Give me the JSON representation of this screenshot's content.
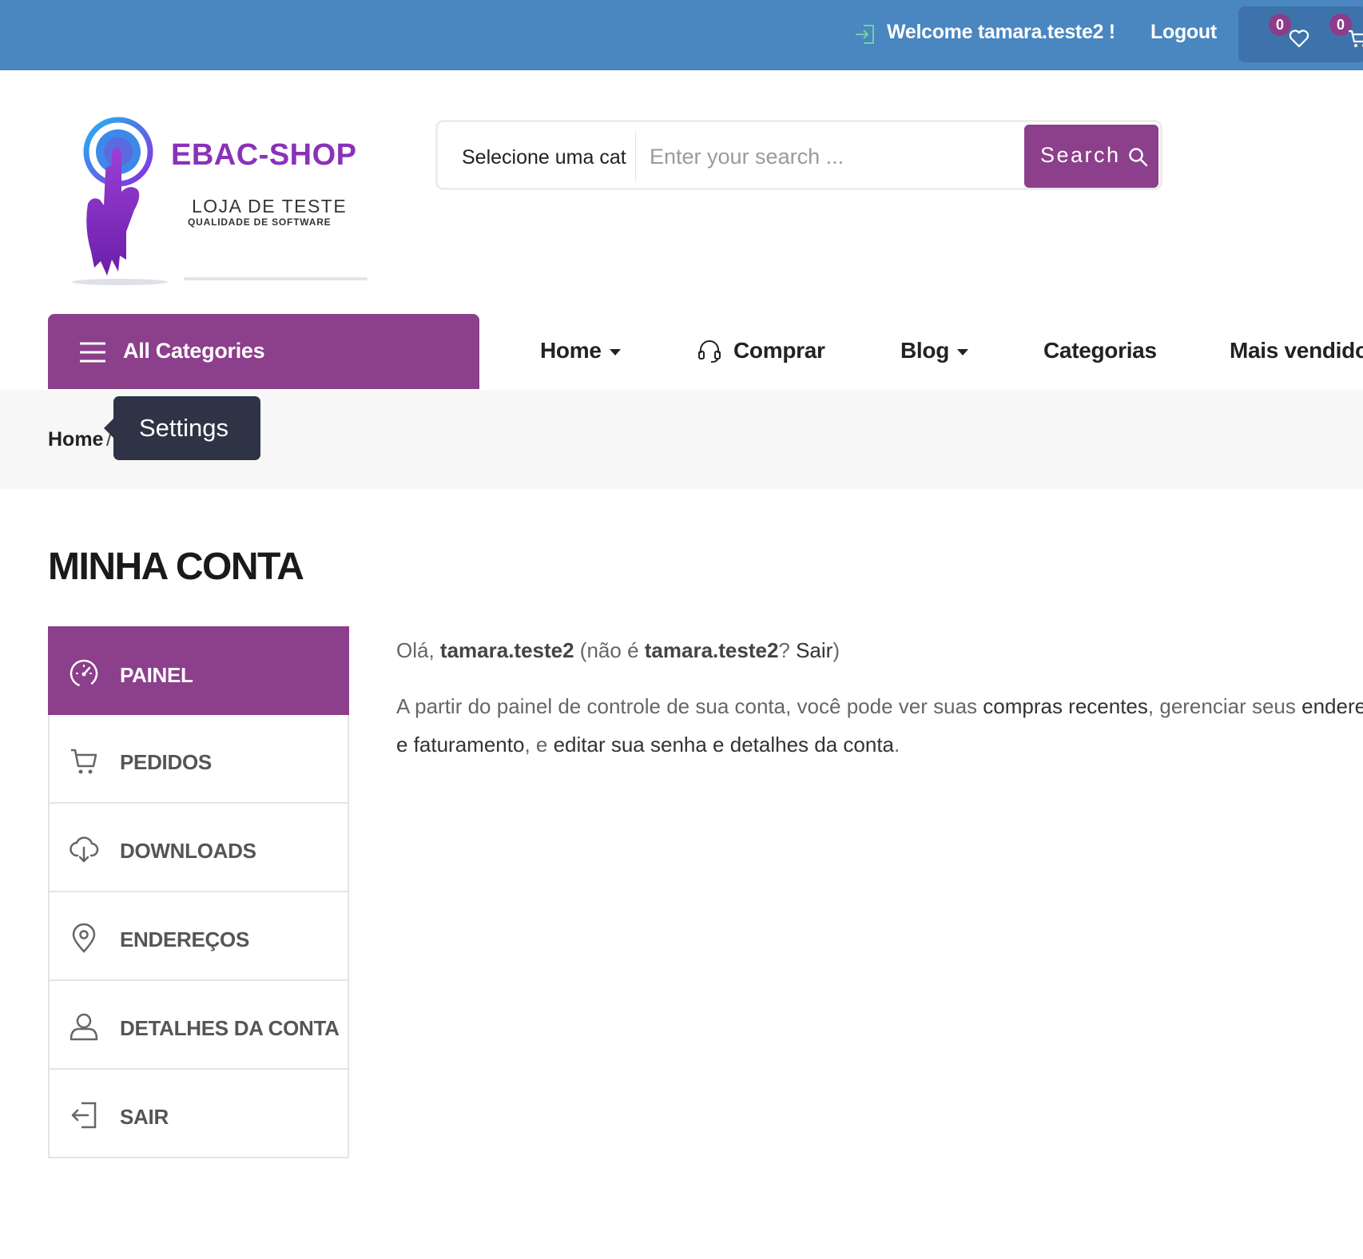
{
  "topbar": {
    "welcome": "Welcome tamara.teste2 !",
    "logout": "Logout",
    "wishlist_count": "0",
    "cart_count": "0",
    "background": "#4a86c0"
  },
  "logo": {
    "title": "EBAC-SHOP",
    "subtitle": "LOJA DE TESTE",
    "tagline": "QUALIDADE DE SOFTWARE"
  },
  "search": {
    "category": "Selecione uma cat",
    "placeholder": "Enter your search ...",
    "button": "Search"
  },
  "nav": {
    "all_categories": "All Categories",
    "items": [
      "Home",
      "Comprar",
      "Blog",
      "Categorias",
      "Mais vendido"
    ]
  },
  "breadcrumb": {
    "home": "Home",
    "separator": "/",
    "tooltip": "Settings"
  },
  "page": {
    "title": "MINHA CONTA"
  },
  "account_menu": [
    {
      "label": "PAINEL",
      "icon": "dashboard-icon",
      "active": true
    },
    {
      "label": "PEDIDOS",
      "icon": "cart-icon",
      "active": false
    },
    {
      "label": "DOWNLOADS",
      "icon": "cloud-download-icon",
      "active": false
    },
    {
      "label": "ENDEREÇOS",
      "icon": "map-pin-icon",
      "active": false
    },
    {
      "label": "DETALHES DA CONTA",
      "icon": "user-icon",
      "active": false
    },
    {
      "label": "SAIR",
      "icon": "logout-icon",
      "active": false
    }
  ],
  "content": {
    "hello_prefix": "Olá, ",
    "username": "tamara.teste2",
    "not_prefix": " (não é ",
    "username2": "tamara.teste2",
    "question": "? ",
    "sair": "Sair",
    "close_paren": ")",
    "p2_a": "A partir do painel de controle de sua conta, você pode ver suas ",
    "p2_link1": "compras recentes",
    "p2_b": ", gerenciar seus ",
    "p2_link2": "endereços de entrega",
    "p2_link2b": "e faturamento",
    "p2_c": ", e ",
    "p2_link3": "editar sua senha e detalhes da conta",
    "p2_d": "."
  },
  "colors": {
    "accent": "#8c3f8b",
    "tooltip_bg": "#2e3345"
  }
}
